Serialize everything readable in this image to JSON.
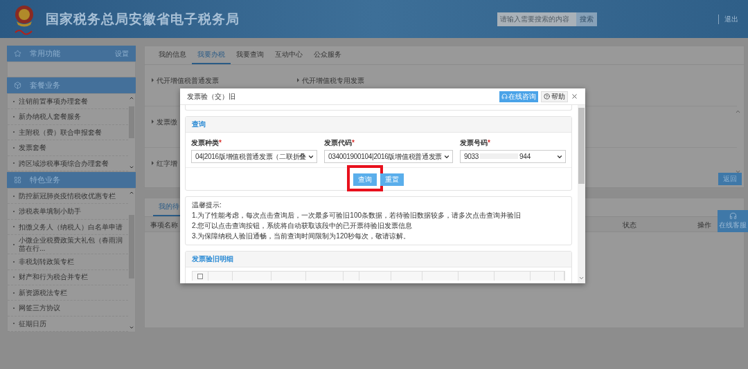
{
  "header": {
    "title": "国家税务总局安徽省电子税务局",
    "search": {
      "placeholder": "请输入需要搜索的内容",
      "button": "搜索"
    },
    "logout": "退出"
  },
  "sidebar": {
    "sections": [
      {
        "kind": "favorites",
        "title": "常用功能",
        "action": "设置"
      },
      {
        "kind": "packages",
        "title": "套餐业务",
        "items": [
          "注销前置事项办理套餐",
          "新办纳税人套餐服务",
          "主附税（费）联合申报套餐",
          "发票套餐",
          "跨区域涉税事项综合办理套餐"
        ]
      },
      {
        "kind": "features",
        "title": "特色业务",
        "items": [
          "防控新冠肺炎疫情税收优惠专栏",
          "涉税表单填制小助手",
          "扣缴义务人（纳税人）白名单申请",
          "小微企业税费政策大礼包（春雨润苗在行...",
          "非税划转政策专栏",
          "财产和行为税合并专栏",
          "新资源税法专栏",
          "网签三方协议",
          "征期日历"
        ]
      }
    ]
  },
  "main": {
    "tabs": [
      {
        "label": "我的信息",
        "selected": false
      },
      {
        "label": "我要办税",
        "selected": true
      },
      {
        "label": "我要查询",
        "selected": false
      },
      {
        "label": "互动中心",
        "selected": false
      },
      {
        "label": "公众服务",
        "selected": false
      }
    ],
    "service_rows": [
      [
        "代开增值税普通发票",
        "代开增值税专用发票"
      ],
      [
        "发票缴"
      ],
      [
        "红字增"
      ]
    ],
    "return_button": "返回"
  },
  "todo": {
    "tabs": [
      {
        "label": "我的待",
        "selected": true
      }
    ],
    "columns": [
      "事项名称",
      "状态",
      "操作"
    ]
  },
  "online_service": "在线客服",
  "dialog": {
    "title": "发票验（交）旧",
    "online_button": "在线咨询",
    "help_button": "帮助",
    "query": {
      "title": "查询",
      "fields": [
        {
          "label": "发票种类",
          "required": true,
          "mark": "*",
          "value": "04|2016版增值税普通发票（二联折叠"
        },
        {
          "label": "发票代码",
          "required": true,
          "mark": "*",
          "value": "034001900104|2016版增值税普通发票"
        },
        {
          "label": "发票号码",
          "required": true,
          "mark": "*",
          "value": "9033",
          "value_end": "944"
        }
      ],
      "buttons": [
        {
          "label": "查询",
          "highlighted": true
        },
        {
          "label": "重置",
          "highlighted": false
        }
      ]
    },
    "tips": {
      "title": "温馨提示:",
      "lines": [
        "1.为了性能考虑，每次点击查询后，一次最多可验旧100条数据，若待验旧数据较多，请多次点击查询并验旧",
        "2.您可以点击查询按钮，系统将自动获取该段中的已开票待验旧发票信息",
        "3.为保障纳税人验旧通畅，当前查询时间限制为120秒每次，敬请谅解。"
      ]
    },
    "detail": {
      "title": "发票验旧明细",
      "select_all_checked": false
    }
  }
}
